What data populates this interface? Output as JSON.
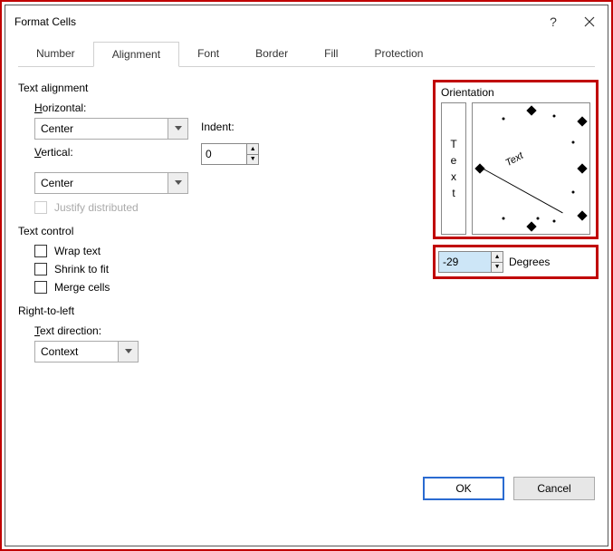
{
  "window": {
    "title": "Format Cells"
  },
  "tabs": {
    "number": "Number",
    "alignment": "Alignment",
    "font": "Font",
    "border": "Border",
    "fill": "Fill",
    "protection": "Protection"
  },
  "sections": {
    "text_alignment": "Text alignment",
    "text_control": "Text control",
    "right_to_left": "Right-to-left",
    "orientation": "Orientation"
  },
  "labels": {
    "horizontal_pre": "H",
    "horizontal_rest": "orizontal:",
    "vertical_pre": "V",
    "vertical_rest": "ertical:",
    "indent": "Indent:",
    "justify_pre": "J",
    "justify_rest": "ustify distributed",
    "wrap_pre": "W",
    "wrap_rest": "rap text",
    "shrink": "Shrin",
    "shrink_u": "k",
    "shrink_rest": " to fit",
    "merge_pre": "M",
    "merge_rest": "erge cells",
    "textdir_pre": "T",
    "textdir_rest": "ext direction:",
    "degrees_pre": "D",
    "degrees_rest": "egrees",
    "text_vertical": "Text",
    "dial_text": "Text"
  },
  "values": {
    "horizontal": "Center",
    "vertical": "Center",
    "indent": "0",
    "text_direction": "Context",
    "degrees": "-29"
  },
  "buttons": {
    "ok": "OK",
    "cancel": "Cancel"
  }
}
